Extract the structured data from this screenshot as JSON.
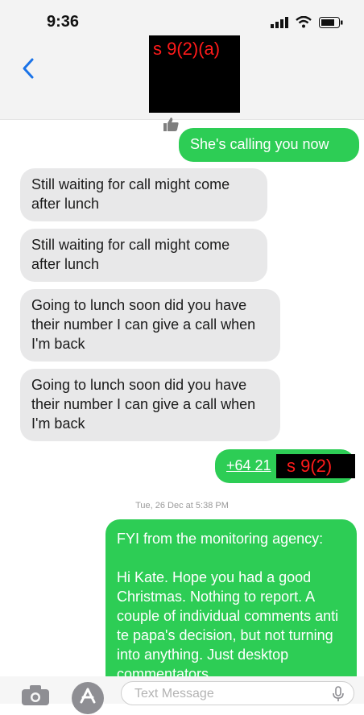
{
  "status_bar": {
    "time": "9:36"
  },
  "header": {
    "redaction_label": "s 9(2)(a)"
  },
  "messages": [
    {
      "text": "She's calling you now"
    },
    {
      "text": "Still waiting for call might come after lunch"
    },
    {
      "text": "Still waiting for call might come after lunch"
    },
    {
      "text": "Going to lunch soon did you have their number I can give a call when I'm back"
    },
    {
      "text": "Going to lunch soon did you have their number I can give a call when I'm back"
    },
    {
      "text": "+64 21",
      "redaction_label": "s 9(2)"
    },
    {
      "text": "FYI from the monitoring agency:\n\nHi Kate. Hope you had a good Christmas. Nothing to report. A couple of individual comments anti te papa's decision, but not turning into anything. Just desktop commentators."
    }
  ],
  "timestamp": "Tue, 26 Dec at 5:38 PM",
  "input": {
    "placeholder": "Text Message"
  }
}
